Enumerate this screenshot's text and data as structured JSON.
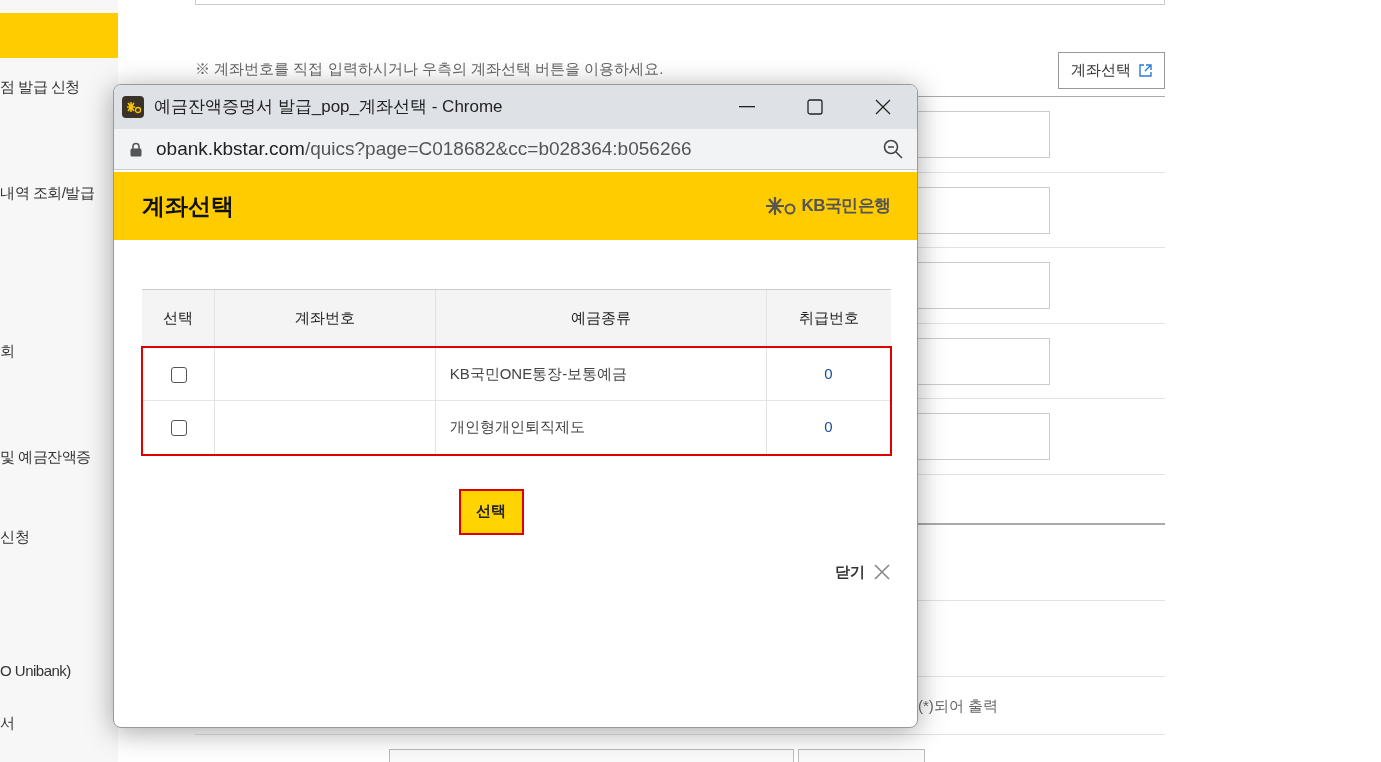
{
  "background": {
    "sidebar": {
      "items": [
        {
          "label": "점 발급 신청",
          "selected": false
        },
        {
          "label": "내역 조회/발급",
          "selected": false
        },
        {
          "label": "회",
          "selected": false
        },
        {
          "label": " 및 예금잔액증",
          "selected": false
        },
        {
          "label": " 신청",
          "selected": false
        },
        {
          "label": "O Unibank)",
          "selected": false
        },
        {
          "label": "서",
          "selected": false
        }
      ]
    },
    "notice": "※ 계좌번호를 직접 입력하시거나 우측의 계좌선택 버튼을 이용하세요.",
    "account_select_button": "계좌선택",
    "footnote": "(*)되어 출력"
  },
  "popup": {
    "window_title": "예금잔액증명서 발급_pop_계좌선택 - Chrome",
    "url": {
      "host": "obank.kbstar.com",
      "path": "/quics?page=C018682&cc=b028364:b056266"
    },
    "heading": "계좌선택",
    "brand": "KB국민은행",
    "table": {
      "columns": [
        "선택",
        "계좌번호",
        "예금종류",
        "취급번호"
      ],
      "rows": [
        {
          "checked": false,
          "deposit_type": "KB국민ONE통장-보통예금",
          "handling_number": "0"
        },
        {
          "checked": false,
          "deposit_type": "개인형개인퇴직제도",
          "handling_number": "0"
        }
      ]
    },
    "select_button": "선택",
    "close_label": "닫기"
  }
}
